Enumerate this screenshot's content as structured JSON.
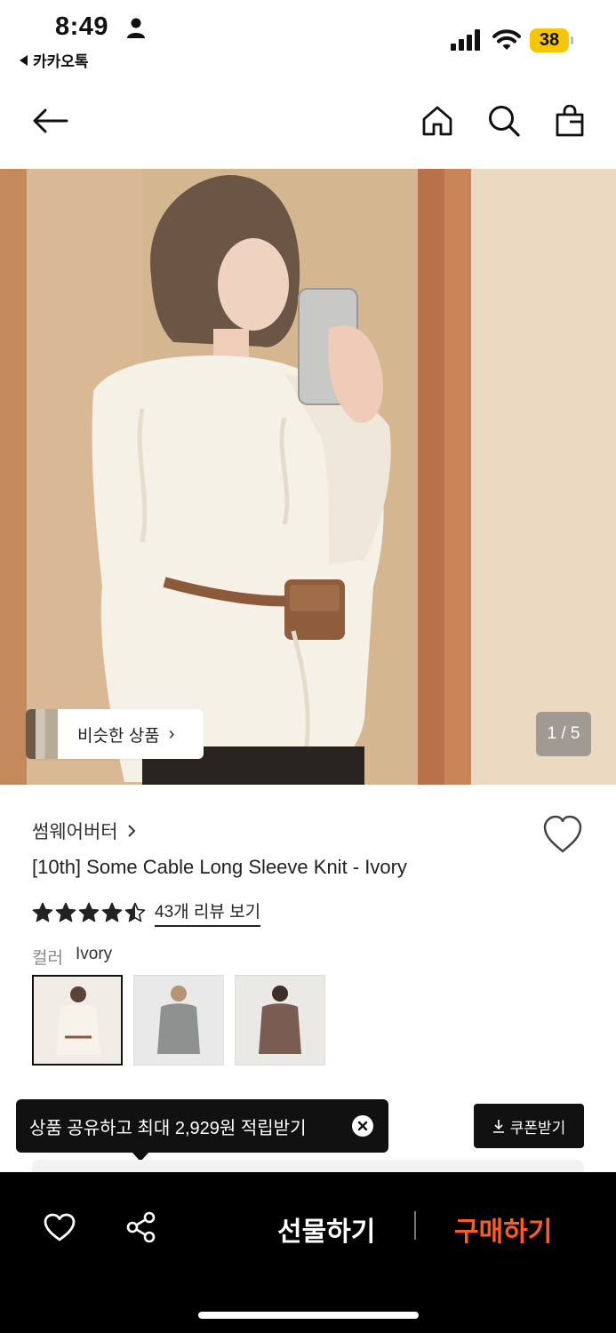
{
  "status_bar": {
    "time": "8:49",
    "back_app": "카카오톡",
    "battery": "38",
    "icons": [
      "person-icon",
      "signal-icon",
      "wifi-icon",
      "battery-icon"
    ]
  },
  "header": {
    "icons": [
      "back-arrow-icon",
      "home-icon",
      "search-icon",
      "shopping-bag-icon"
    ]
  },
  "gallery": {
    "similar_label": "비슷한 상품",
    "page_counter": "1 / 5"
  },
  "product": {
    "brand": "썸웨어버터",
    "title": "[10th] Some Cable Long Sleeve Knit - Ivory",
    "rating": 4.5,
    "review_link": "43개 리뷰 보기",
    "color_label": "컬러",
    "color_value": "Ivory",
    "swatches": [
      {
        "name": "Ivory",
        "color": "#efe8dc",
        "selected": true
      },
      {
        "name": "Gray",
        "color": "#8f9090",
        "selected": false
      },
      {
        "name": "Brown",
        "color": "#7a5c52",
        "selected": false
      }
    ]
  },
  "promo": {
    "tooltip": "상품 공유하고 최대 2,929원 적립받기",
    "coupon_button": "쿠폰받기"
  },
  "bottom_bar": {
    "gift_button": "선물하기",
    "buy_button": "구매하기",
    "buy_color": "#ff5a1f"
  }
}
